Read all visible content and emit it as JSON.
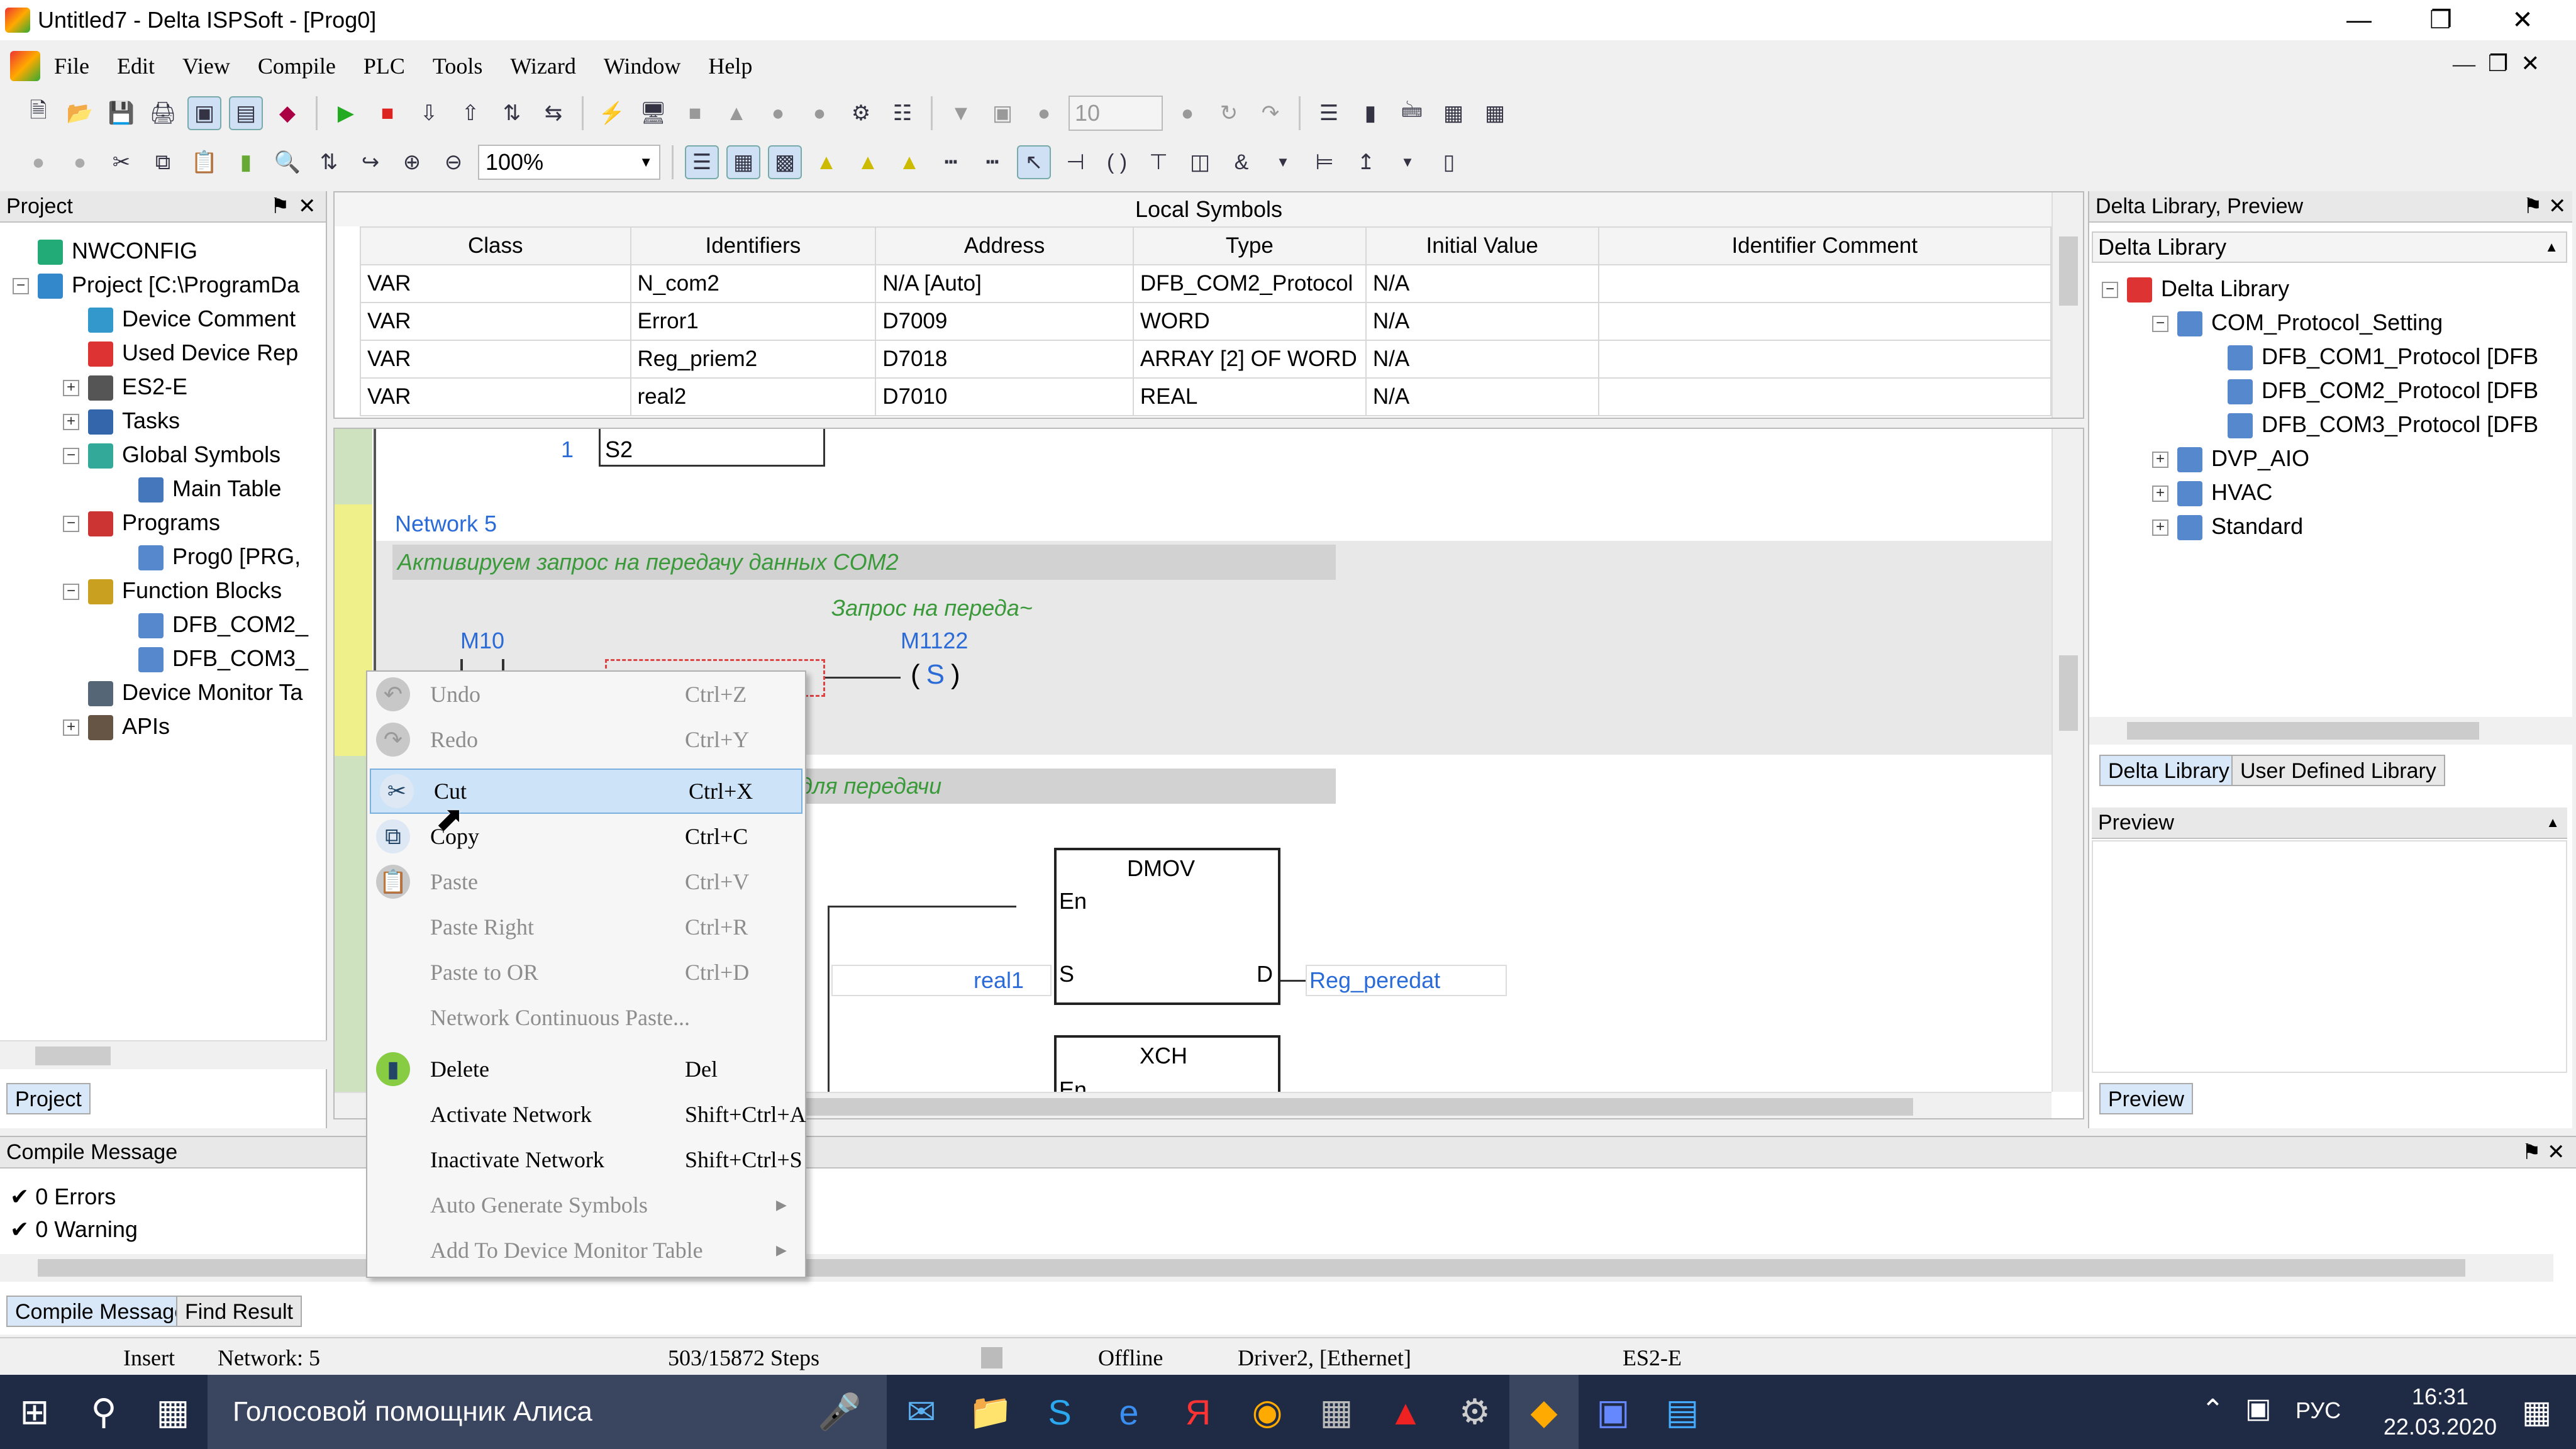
{
  "window": {
    "title": "Untitled7 - Delta ISPSoft - [Prog0]"
  },
  "menu": [
    "File",
    "Edit",
    "View",
    "Compile",
    "PLC",
    "Tools",
    "Wizard",
    "Window",
    "Help"
  ],
  "toolbar": {
    "zoom": "100%",
    "stepper_value": "10"
  },
  "project": {
    "title": "Project",
    "tab": "Project",
    "items": [
      {
        "label": "NWCONFIG",
        "level": 0,
        "exp": "",
        "icon": "network-icon"
      },
      {
        "label": "Project [C:\\ProgramDa",
        "level": 0,
        "exp": "−",
        "icon": "project-icon"
      },
      {
        "label": "Device Comment",
        "level": 1,
        "exp": "",
        "icon": "comment-icon"
      },
      {
        "label": "Used Device Rep",
        "level": 1,
        "exp": "",
        "icon": "device-icon"
      },
      {
        "label": "ES2-E",
        "level": 1,
        "exp": "+",
        "icon": "plc-icon"
      },
      {
        "label": "Tasks",
        "level": 1,
        "exp": "+",
        "icon": "tasks-icon"
      },
      {
        "label": "Global Symbols",
        "level": 1,
        "exp": "−",
        "icon": "globe-icon"
      },
      {
        "label": "Main Table",
        "level": 2,
        "exp": "",
        "icon": "table-icon"
      },
      {
        "label": "Programs",
        "level": 1,
        "exp": "−",
        "icon": "programs-icon"
      },
      {
        "label": "Prog0 [PRG,",
        "level": 2,
        "exp": "",
        "icon": "program-icon"
      },
      {
        "label": "Function Blocks",
        "level": 1,
        "exp": "−",
        "icon": "function-blocks-icon"
      },
      {
        "label": "DFB_COM2_",
        "level": 2,
        "exp": "",
        "icon": "block-icon"
      },
      {
        "label": "DFB_COM3_",
        "level": 2,
        "exp": "",
        "icon": "block-icon"
      },
      {
        "label": "Device Monitor Ta",
        "level": 1,
        "exp": "",
        "icon": "monitor-icon"
      },
      {
        "label": "APIs",
        "level": 1,
        "exp": "+",
        "icon": "api-icon"
      }
    ]
  },
  "symbols": {
    "title": "Local Symbols",
    "columns": [
      "Class",
      "Identifiers",
      "Address",
      "Type",
      "Initial Value",
      "Identifier Comment"
    ],
    "rows": [
      [
        "VAR",
        "N_com2",
        "N/A [Auto]",
        "DFB_COM2_Protocol",
        "N/A",
        ""
      ],
      [
        "VAR",
        "Error1",
        "D7009",
        "WORD",
        "N/A",
        ""
      ],
      [
        "VAR",
        "Reg_priem2",
        "D7018",
        "ARRAY [2] OF WORD",
        "N/A",
        ""
      ],
      [
        "VAR",
        "real2",
        "D7010",
        "REAL",
        "N/A",
        ""
      ]
    ]
  },
  "ladder": {
    "top_num": "1",
    "top_label": "S2",
    "network5": "Network 5",
    "comment1": "Активируем запрос на передачу данных COM2",
    "coil_comment": "Запрос на переда~",
    "contact": "M10",
    "coil": "M1122",
    "coil_sym": "S",
    "comment2_tail": "й для передачи",
    "dmov": "DMOV",
    "en": "En",
    "s": "S",
    "d": "D",
    "in_var": "real1",
    "out_var": "Reg_peredat",
    "xch": "XCH",
    "en2": "En"
  },
  "context_menu": [
    {
      "label": "Undo",
      "shortcut": "Ctrl+Z",
      "disabled": true,
      "icon": "undo-icon"
    },
    {
      "label": "Redo",
      "shortcut": "Ctrl+Y",
      "disabled": true,
      "icon": "redo-icon"
    },
    {
      "label": "Cut",
      "shortcut": "Ctrl+X",
      "disabled": false,
      "selected": true,
      "icon": "scissors-icon"
    },
    {
      "label": "Copy",
      "shortcut": "Ctrl+C",
      "disabled": false,
      "icon": "copy-icon"
    },
    {
      "label": "Paste",
      "shortcut": "Ctrl+V",
      "disabled": true,
      "icon": "paste-icon"
    },
    {
      "label": "Paste Right",
      "shortcut": "Ctrl+R",
      "disabled": true,
      "icon": ""
    },
    {
      "label": "Paste to OR",
      "shortcut": "Ctrl+D",
      "disabled": true,
      "icon": ""
    },
    {
      "label": "Network Continuous Paste...",
      "shortcut": "",
      "disabled": true,
      "icon": ""
    },
    {
      "label": "Delete",
      "shortcut": "Del",
      "disabled": false,
      "icon": "eraser-icon"
    },
    {
      "label": "Activate Network",
      "shortcut": "Shift+Ctrl+A",
      "disabled": false,
      "icon": ""
    },
    {
      "label": "Inactivate Network",
      "shortcut": "Shift+Ctrl+S",
      "disabled": false,
      "icon": ""
    },
    {
      "label": "Auto Generate Symbols",
      "shortcut": "",
      "disabled": true,
      "submenu": true,
      "icon": ""
    },
    {
      "label": "Add To Device Monitor Table",
      "shortcut": "",
      "disabled": true,
      "submenu": true,
      "icon": ""
    }
  ],
  "library": {
    "title": "Delta Library, Preview",
    "dropdown": "Delta Library",
    "items": [
      {
        "label": "Delta Library",
        "level": 0,
        "exp": "−"
      },
      {
        "label": "COM_Protocol_Setting",
        "level": 1,
        "exp": "−"
      },
      {
        "label": "DFB_COM1_Protocol [DFB",
        "level": 2,
        "exp": ""
      },
      {
        "label": "DFB_COM2_Protocol [DFB",
        "level": 2,
        "exp": ""
      },
      {
        "label": "DFB_COM3_Protocol [DFB",
        "level": 2,
        "exp": ""
      },
      {
        "label": "DVP_AIO",
        "level": 1,
        "exp": "+"
      },
      {
        "label": "HVAC",
        "level": 1,
        "exp": "+"
      },
      {
        "label": "Standard",
        "level": 1,
        "exp": "+"
      }
    ],
    "tabs": [
      "Delta Library",
      "User Defined Library"
    ],
    "preview_title": "Preview",
    "preview_tab": "Preview"
  },
  "compile": {
    "title": "Compile Message",
    "errors": "0 Errors",
    "warnings": "0 Warning",
    "tabs": [
      "Compile Message",
      "Find Result"
    ]
  },
  "status": {
    "mode": "Insert",
    "network": "Network: 5",
    "steps": "503/15872 Steps",
    "conn": "Offline",
    "driver": "Driver2, [Ethernet]",
    "plc": "ES2-E"
  },
  "taskbar": {
    "search": "Голосовой помощник Алиса",
    "lang": "РУС",
    "time": "16:31",
    "date": "22.03.2020"
  }
}
